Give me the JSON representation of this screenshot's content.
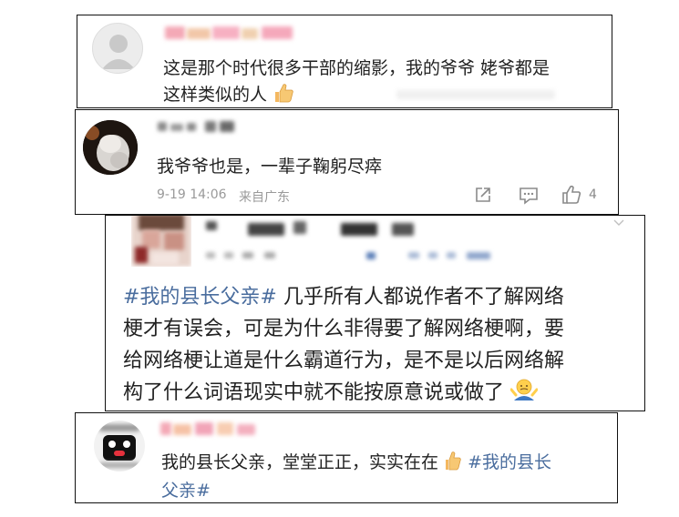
{
  "comments": [
    {
      "user_name": "",
      "text_line1": "这是那个时代很多干部的缩影，我的爷爷 姥爷都是",
      "text_line2": "这样类似的人",
      "emoji": "thumbs-up-icon"
    },
    {
      "user_name": "",
      "text": "我爷爷也是，一辈子鞠躬尽瘁",
      "timestamp": "9-19 14:06",
      "location": "来自广东",
      "like_count": "4",
      "icons": [
        "share-icon",
        "comment-icon",
        "like-icon"
      ]
    },
    {
      "user_name": "",
      "hashtag": "#我的县长父亲#",
      "text_line1_rest": " 几乎所有人都说作者不了解网络",
      "text_line2": "梗才有误会，可是为什么非得要了解网络梗啊，要",
      "text_line3": "给网络梗让道是什么霸道行为，是不是以后网络解",
      "text_line4": "构了什么词语现实中就不能按原意说或做了",
      "emoji": "shrug-icon"
    },
    {
      "user_name": "",
      "text_line1_prefix": "我的县长父亲，堂堂正正，实实在在",
      "hashtag_line1": "#我的县长",
      "hashtag_line2": "父亲#",
      "emoji": "thumbs-up-icon"
    }
  ],
  "colors": {
    "hashtag": "#4a6d9e",
    "meta": "#9a9a9a",
    "border": "#111111"
  }
}
